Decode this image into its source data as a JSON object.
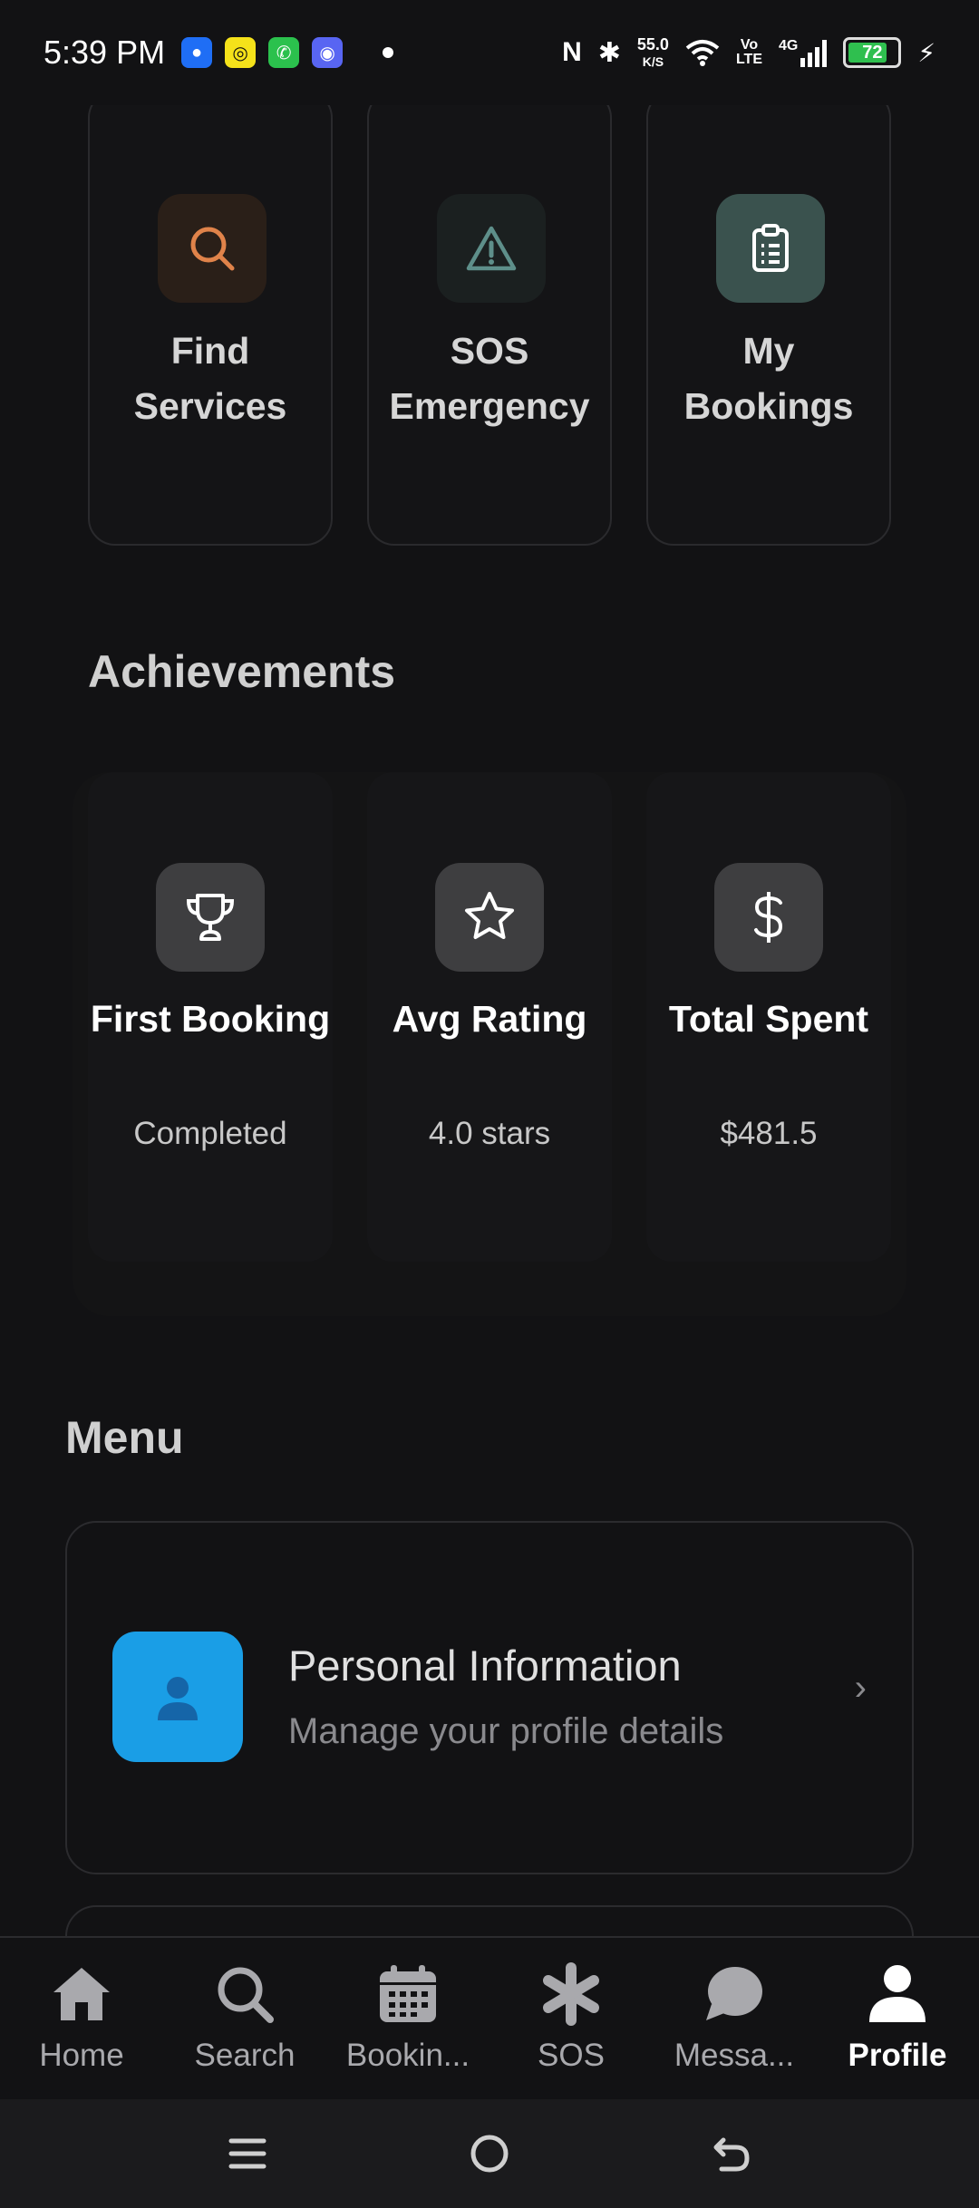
{
  "status_bar": {
    "time": "5:39 PM",
    "net_speed_value": "55.0",
    "net_speed_unit": "K/S",
    "network_type": "4G",
    "volte": "Vo\nLTE",
    "battery": "72"
  },
  "quick_actions": [
    {
      "label": "Find Services",
      "icon": "search-icon",
      "color": "#e0834a"
    },
    {
      "label": "SOS Emergency",
      "icon": "warning-icon",
      "color": "#5e8f8a"
    },
    {
      "label": "My Bookings",
      "icon": "clipboard-icon",
      "color": "#ffffff"
    }
  ],
  "achievements": {
    "title": "Achievements",
    "items": [
      {
        "title": "First Booking",
        "value": "Completed",
        "icon": "trophy-icon"
      },
      {
        "title": "Avg Rating",
        "value": "4.0 stars",
        "icon": "star-icon"
      },
      {
        "title": "Total Spent",
        "value": "$481.5",
        "icon": "dollar-icon"
      }
    ]
  },
  "menu": {
    "title": "Menu",
    "items": [
      {
        "title": "Personal Information",
        "subtitle": "Manage your profile details",
        "icon": "person-icon",
        "color": "#1a9ee6"
      }
    ]
  },
  "tabs": [
    {
      "label": "Home",
      "icon": "home-icon"
    },
    {
      "label": "Search",
      "icon": "search-icon"
    },
    {
      "label": "Bookin...",
      "icon": "calendar-icon"
    },
    {
      "label": "SOS",
      "icon": "asterisk-icon"
    },
    {
      "label": "Messa...",
      "icon": "chat-icon"
    },
    {
      "label": "Profile",
      "icon": "person-icon",
      "active": true
    }
  ]
}
